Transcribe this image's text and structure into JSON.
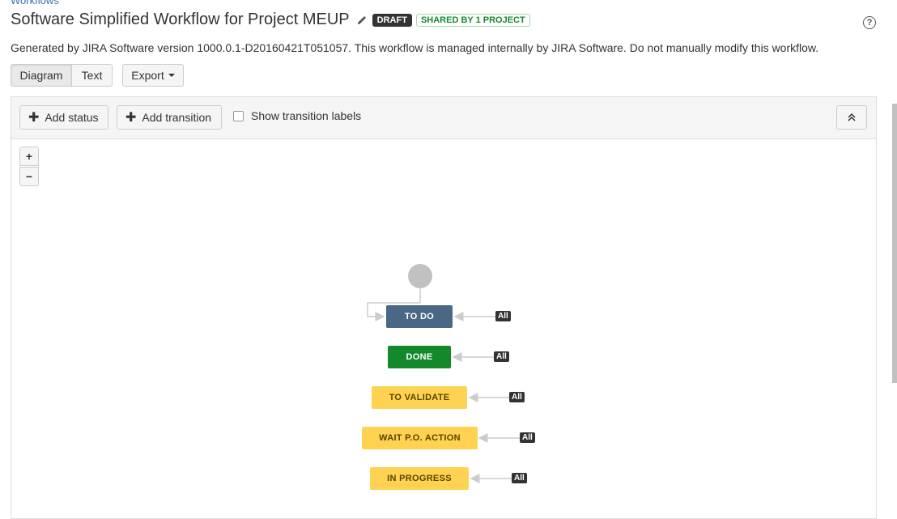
{
  "breadcrumb": "Workflows",
  "title": "Software Simplified Workflow for Project MEUP",
  "badges": {
    "draft": "DRAFT",
    "shared": "SHARED BY 1 PROJECT"
  },
  "help_icon": "?",
  "description": "Generated by JIRA Software version 1000.0.1-D20160421T051057. This workflow is managed internally by JIRA Software. Do not manually modify this workflow.",
  "view_tabs": {
    "diagram": "Diagram",
    "text": "Text",
    "export": "Export"
  },
  "toolbar": {
    "add_status": "Add status",
    "add_transition": "Add transition",
    "show_labels": "Show transition labels"
  },
  "zoom": {
    "in": "+",
    "out": "−"
  },
  "statuses": [
    {
      "label": "TO DO",
      "color": "#4a6785",
      "text_color": "#ffffff"
    },
    {
      "label": "DONE",
      "color": "#14892c",
      "text_color": "#ffffff"
    },
    {
      "label": "TO VALIDATE",
      "color": "#ffd351",
      "text_color": "#594300"
    },
    {
      "label": "WAIT P.O. ACTION",
      "color": "#ffd351",
      "text_color": "#594300"
    },
    {
      "label": "IN PROGRESS",
      "color": "#ffd351",
      "text_color": "#594300"
    }
  ],
  "all_label": "All"
}
